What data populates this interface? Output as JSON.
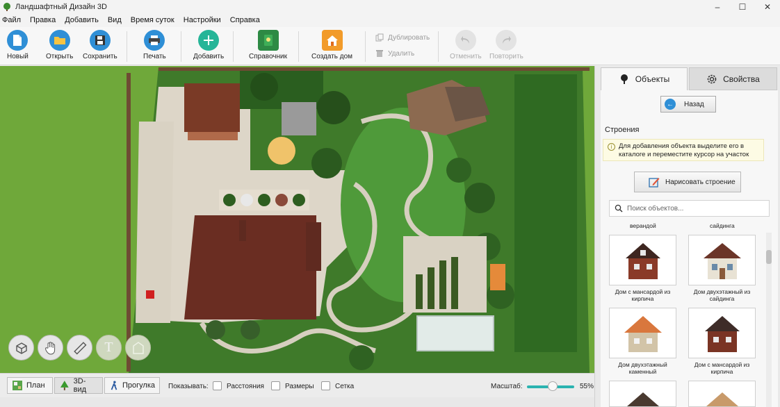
{
  "window": {
    "title": "Ландшафтный Дизайн 3D",
    "minimize": "–",
    "maximize": "☐",
    "close": "✕"
  },
  "menu": [
    "Файл",
    "Правка",
    "Добавить",
    "Вид",
    "Время суток",
    "Настройки",
    "Справка"
  ],
  "toolbar": {
    "new": "Новый",
    "open": "Открыть",
    "save": "Сохранить",
    "print": "Печать",
    "add": "Добавить",
    "reference": "Справочник",
    "create_house": "Создать дом",
    "duplicate": "Дублировать",
    "delete": "Удалить",
    "undo": "Отменить",
    "redo": "Повторить"
  },
  "map_tools": [
    "move-3d-icon",
    "hand-icon",
    "ruler-icon",
    "text-icon",
    "building-icon"
  ],
  "map_tools_text": {
    "text_tool": "T"
  },
  "bottom": {
    "views": {
      "plan": "План",
      "view3d": "3D-вид",
      "walk": "Прогулка"
    },
    "active_view": "3D-вид",
    "show_label": "Показывать:",
    "checks": {
      "distances": "Расстояния",
      "sizes": "Размеры",
      "grid": "Сетка"
    },
    "scale_label": "Масштаб:",
    "scale_value": "55%",
    "scale_fraction": 0.55
  },
  "panel": {
    "tabs": {
      "objects": "Объекты",
      "properties": "Свойства"
    },
    "active_tab": "Объекты",
    "back": "Назад",
    "section": "Строения",
    "hint": "Для добавления объекта выделите его в каталоге и переместите курсор на участок",
    "hint_icon": "i",
    "draw_building": "Нарисовать строение",
    "search_placeholder": "Поиск объектов...",
    "top_captions": [
      "верандой",
      "сайдинга"
    ],
    "items": [
      {
        "caption": "Дом с мансардой из кирпича",
        "roof": "#4a2a22",
        "wall": "#8a3a28"
      },
      {
        "caption": "Дом двухэтажный из сайдинга",
        "roof": "#6b3528",
        "wall": "#e8e2d4"
      },
      {
        "caption": "Дом двухэтажный каменный",
        "roof": "#d9773d",
        "wall": "#d2c4a8"
      },
      {
        "caption": "Дом с мансардой из кирпича",
        "roof": "#3e2c28",
        "wall": "#7a3424"
      }
    ]
  }
}
